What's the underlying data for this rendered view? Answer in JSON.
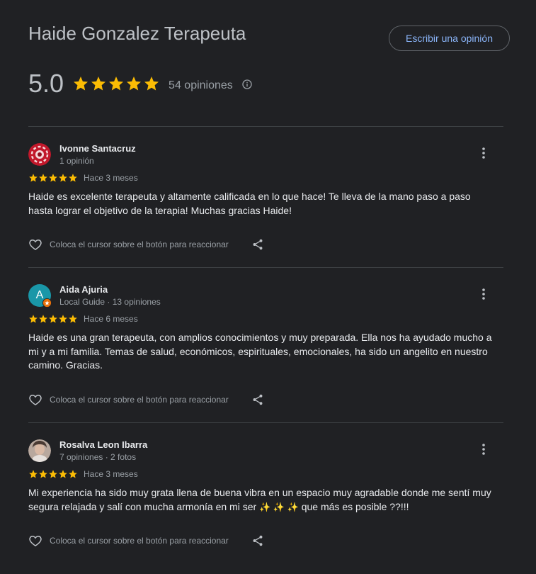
{
  "header": {
    "title": "Haide Gonzalez Terapeuta",
    "write_review_label": "Escribir una opinión"
  },
  "summary": {
    "rating": "5.0",
    "stars": 5,
    "count_label": "54 opiniones"
  },
  "react_label": "Coloca el cursor sobre el botón para reaccionar",
  "colors": {
    "star": "#fbbc04",
    "accent": "#8ab4f8",
    "background": "#202124"
  },
  "reviews": [
    {
      "name": "Ivonne Santacruz",
      "meta": "1 opinión",
      "stars": 5,
      "date": "Hace 3 meses",
      "text": "Haide es excelente terapeuta y altamente calificada en lo que hace! Te lleva de la mano paso a paso hasta lograr el objetivo de la terapia! Muchas gracias Haide!"
    },
    {
      "name": "Aida Ajuria",
      "meta": "Local Guide · 13 opiniones",
      "avatar_letter": "A",
      "stars": 5,
      "date": "Hace 6 meses",
      "text": "Haide es una gran terapeuta, con amplios conocimientos y muy preparada. Ella nos ha ayudado mucho a mi y a mi familia. Temas de salud, económicos, espirituales, emocionales, ha sido un angelito en nuestro camino. Gracias."
    },
    {
      "name": "Rosalva Leon Ibarra",
      "meta": "7 opiniones · 2 fotos",
      "stars": 5,
      "date": "Hace 3 meses",
      "text_before": "Mi experiencia ha sido muy grata llena de buena vibra en un espacio muy agradable donde me sentí muy segura relajada y salí con mucha armonía en mi ser ",
      "sparkles": "✨ ✨ ✨",
      "text_after": "que más es posible ??!!!"
    }
  ]
}
